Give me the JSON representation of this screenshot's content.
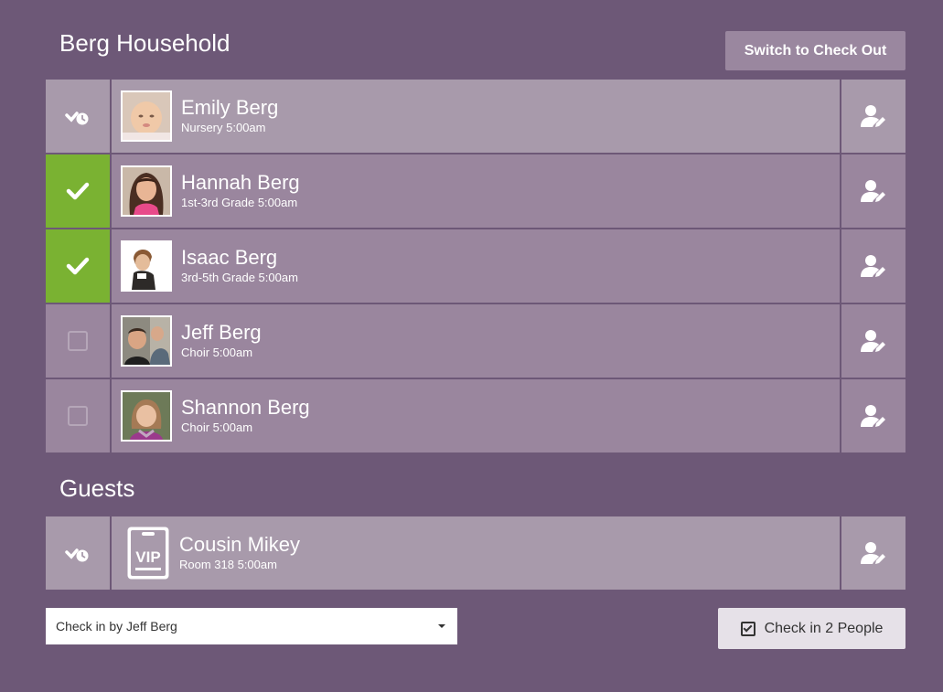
{
  "household": {
    "title": "Berg Household",
    "switch_label": "Switch to Check Out",
    "members": [
      {
        "name": "Emily Berg",
        "detail": "Nursery 5:00am",
        "status": "pending",
        "avatar": "photo-baby"
      },
      {
        "name": "Hannah Berg",
        "detail": "1st-3rd Grade 5:00am",
        "status": "checked",
        "avatar": "photo-girl"
      },
      {
        "name": "Isaac Berg",
        "detail": "3rd-5th Grade 5:00am",
        "status": "checked",
        "avatar": "photo-boy"
      },
      {
        "name": "Jeff Berg",
        "detail": "Choir 5:00am",
        "status": "unchecked",
        "avatar": "photo-man"
      },
      {
        "name": "Shannon Berg",
        "detail": "Choir 5:00am",
        "status": "unchecked",
        "avatar": "photo-woman"
      }
    ]
  },
  "guests": {
    "title": "Guests",
    "members": [
      {
        "name": "Cousin Mikey",
        "detail": "Room 318 5:00am",
        "status": "pending",
        "avatar": "vip-badge",
        "badge_text": "VIP"
      }
    ]
  },
  "footer": {
    "checkin_by": "Check in by Jeff Berg",
    "checkin_button": "Check in 2 People"
  },
  "icons": {
    "pending": "check-clock-icon",
    "checked": "checkmark-icon",
    "unchecked": "empty-checkbox-icon",
    "edit": "edit-person-icon",
    "caret": "caret-down-icon"
  },
  "colors": {
    "background": "#6d5877",
    "row": "#9a869e",
    "row_highlight": "#a89aab",
    "checked": "#7ab232"
  }
}
